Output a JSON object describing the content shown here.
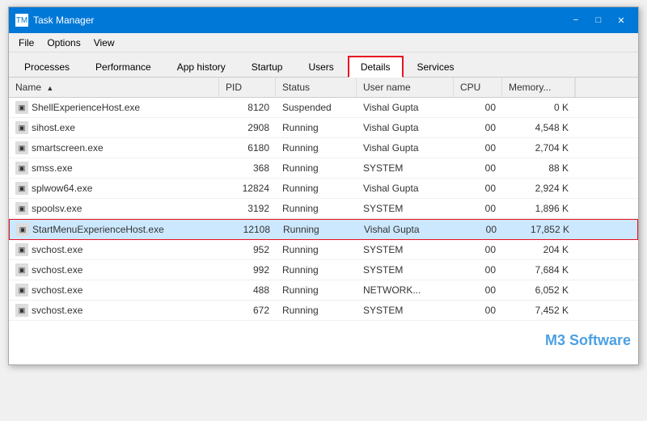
{
  "titleBar": {
    "title": "Task Manager",
    "minimize": "−",
    "maximize": "□",
    "close": "✕"
  },
  "menuBar": {
    "items": [
      "File",
      "Options",
      "View"
    ]
  },
  "tabs": [
    {
      "label": "Processes",
      "active": false
    },
    {
      "label": "Performance",
      "active": false
    },
    {
      "label": "App history",
      "active": false
    },
    {
      "label": "Startup",
      "active": false
    },
    {
      "label": "Users",
      "active": false
    },
    {
      "label": "Details",
      "active": true
    },
    {
      "label": "Services",
      "active": false
    }
  ],
  "table": {
    "columns": [
      {
        "label": "Name",
        "sort": "▲"
      },
      {
        "label": "PID",
        "sort": ""
      },
      {
        "label": "Status",
        "sort": ""
      },
      {
        "label": "User name",
        "sort": ""
      },
      {
        "label": "CPU",
        "sort": ""
      },
      {
        "label": "Memory...",
        "sort": ""
      }
    ],
    "rows": [
      {
        "name": "ShellExperienceHost.exe",
        "pid": "8120",
        "status": "Suspended",
        "user": "Vishal Gupta",
        "cpu": "00",
        "memory": "0 K",
        "highlighted": false
      },
      {
        "name": "sihost.exe",
        "pid": "2908",
        "status": "Running",
        "user": "Vishal Gupta",
        "cpu": "00",
        "memory": "4,548 K",
        "highlighted": false
      },
      {
        "name": "smartscreen.exe",
        "pid": "6180",
        "status": "Running",
        "user": "Vishal Gupta",
        "cpu": "00",
        "memory": "2,704 K",
        "highlighted": false
      },
      {
        "name": "smss.exe",
        "pid": "368",
        "status": "Running",
        "user": "SYSTEM",
        "cpu": "00",
        "memory": "88 K",
        "highlighted": false
      },
      {
        "name": "splwow64.exe",
        "pid": "12824",
        "status": "Running",
        "user": "Vishal Gupta",
        "cpu": "00",
        "memory": "2,924 K",
        "highlighted": false
      },
      {
        "name": "spoolsv.exe",
        "pid": "3192",
        "status": "Running",
        "user": "SYSTEM",
        "cpu": "00",
        "memory": "1,896 K",
        "highlighted": false
      },
      {
        "name": "StartMenuExperienceHost.exe",
        "pid": "12108",
        "status": "Running",
        "user": "Vishal Gupta",
        "cpu": "00",
        "memory": "17,852 K",
        "highlighted": true
      },
      {
        "name": "svchost.exe",
        "pid": "952",
        "status": "Running",
        "user": "SYSTEM",
        "cpu": "00",
        "memory": "204 K",
        "highlighted": false
      },
      {
        "name": "svchost.exe",
        "pid": "992",
        "status": "Running",
        "user": "SYSTEM",
        "cpu": "00",
        "memory": "7,684 K",
        "highlighted": false
      },
      {
        "name": "svchost.exe",
        "pid": "488",
        "status": "Running",
        "user": "NETWORK...",
        "cpu": "00",
        "memory": "6,052 K",
        "highlighted": false
      },
      {
        "name": "svchost.exe",
        "pid": "672",
        "status": "Running",
        "user": "SYSTEM",
        "cpu": "00",
        "memory": "7,452 K",
        "highlighted": false
      }
    ]
  },
  "watermark": "M3 Software"
}
